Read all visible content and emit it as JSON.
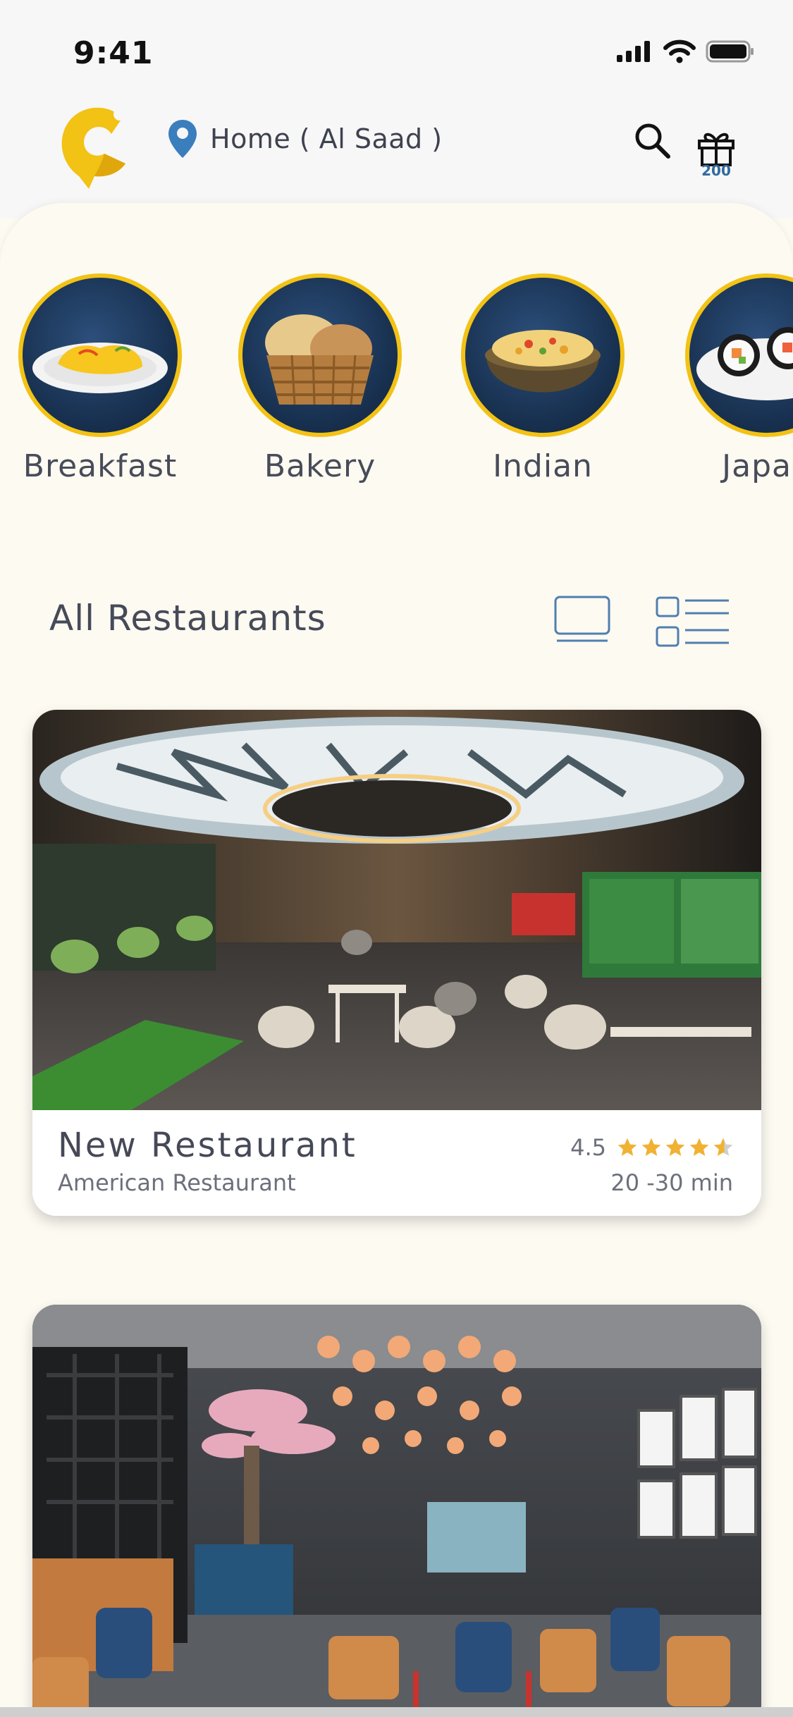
{
  "status_bar": {
    "time": "9:41"
  },
  "header": {
    "location_label": "Home ( Al Saad )",
    "gift_count": "200"
  },
  "categories": [
    {
      "label": "Breakfast",
      "icon": "omelette-plate-icon"
    },
    {
      "label": "Bakery",
      "icon": "bread-basket-icon"
    },
    {
      "label": "Indian",
      "icon": "biryani-pot-icon"
    },
    {
      "label": "Japan",
      "icon": "sushi-plate-icon"
    }
  ],
  "section": {
    "title": "All Restaurants"
  },
  "restaurants": [
    {
      "name": "New Restaurant",
      "cuisine": "American Restaurant",
      "rating": "4.5",
      "rating_stars": 4.5,
      "delivery_time": "20 -30 min"
    }
  ],
  "colors": {
    "accent_yellow": "#f2c215",
    "star": "#f0b233",
    "text": "#464a58",
    "icon_blue": "#4f7fb0",
    "background": "#fcfaf1"
  }
}
